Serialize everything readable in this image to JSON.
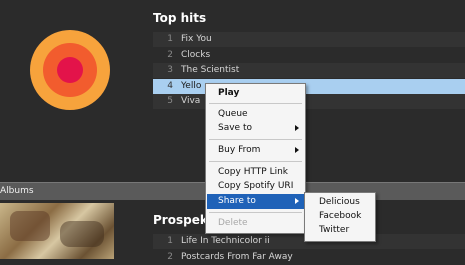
{
  "top": {
    "title": "Top hits",
    "tracks": [
      {
        "num": "1",
        "title": "Fix You"
      },
      {
        "num": "2",
        "title": "Clocks"
      },
      {
        "num": "3",
        "title": "The Scientist"
      },
      {
        "num": "4",
        "title": "Yello"
      },
      {
        "num": "5",
        "title": "Viva"
      }
    ]
  },
  "albums": {
    "header": "Albums",
    "album_title": "Prospekt",
    "tracks": [
      {
        "num": "1",
        "title": "Life In Technicolor ii"
      },
      {
        "num": "2",
        "title": "Postcards From Far Away"
      }
    ]
  },
  "context_menu": {
    "play": "Play",
    "queue": "Queue",
    "save_to": "Save to",
    "buy_from": "Buy From",
    "copy_http": "Copy HTTP Link",
    "copy_uri": "Copy Spotify URI",
    "share_to": "Share to",
    "delete": "Delete"
  },
  "share_menu": {
    "items": [
      "Delicious",
      "Facebook",
      "Twitter"
    ]
  },
  "colors": {
    "background": "#2b2b2b",
    "selected_row": "#a9cff0",
    "menu_highlight": "#1f62b8"
  }
}
